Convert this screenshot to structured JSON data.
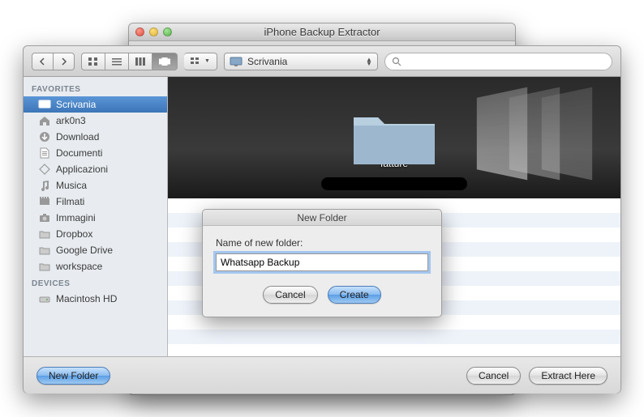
{
  "window": {
    "title": "iPhone Backup Extractor"
  },
  "toolbar": {
    "location_label": "Scrivania"
  },
  "sidebar": {
    "favorites_heading": "FAVORITES",
    "devices_heading": "DEVICES",
    "items": [
      {
        "label": "Scrivania",
        "icon": "desktop"
      },
      {
        "label": "ark0n3",
        "icon": "home"
      },
      {
        "label": "Download",
        "icon": "download"
      },
      {
        "label": "Documenti",
        "icon": "document"
      },
      {
        "label": "Applicazioni",
        "icon": "app"
      },
      {
        "label": "Musica",
        "icon": "music"
      },
      {
        "label": "Filmati",
        "icon": "movie"
      },
      {
        "label": "Immagini",
        "icon": "camera"
      },
      {
        "label": "Dropbox",
        "icon": "folder"
      },
      {
        "label": "Google Drive",
        "icon": "folder"
      },
      {
        "label": "workspace",
        "icon": "folder"
      }
    ],
    "devices": [
      {
        "label": "Macintosh HD",
        "icon": "disk"
      }
    ]
  },
  "coverflow": {
    "selected_label": "fatture"
  },
  "footer": {
    "new_folder_label": "New Folder",
    "cancel_label": "Cancel",
    "extract_label": "Extract Here"
  },
  "sheet": {
    "title": "New Folder",
    "prompt": "Name of new folder:",
    "input_value": "Whatsapp Backup",
    "cancel_label": "Cancel",
    "create_label": "Create"
  }
}
